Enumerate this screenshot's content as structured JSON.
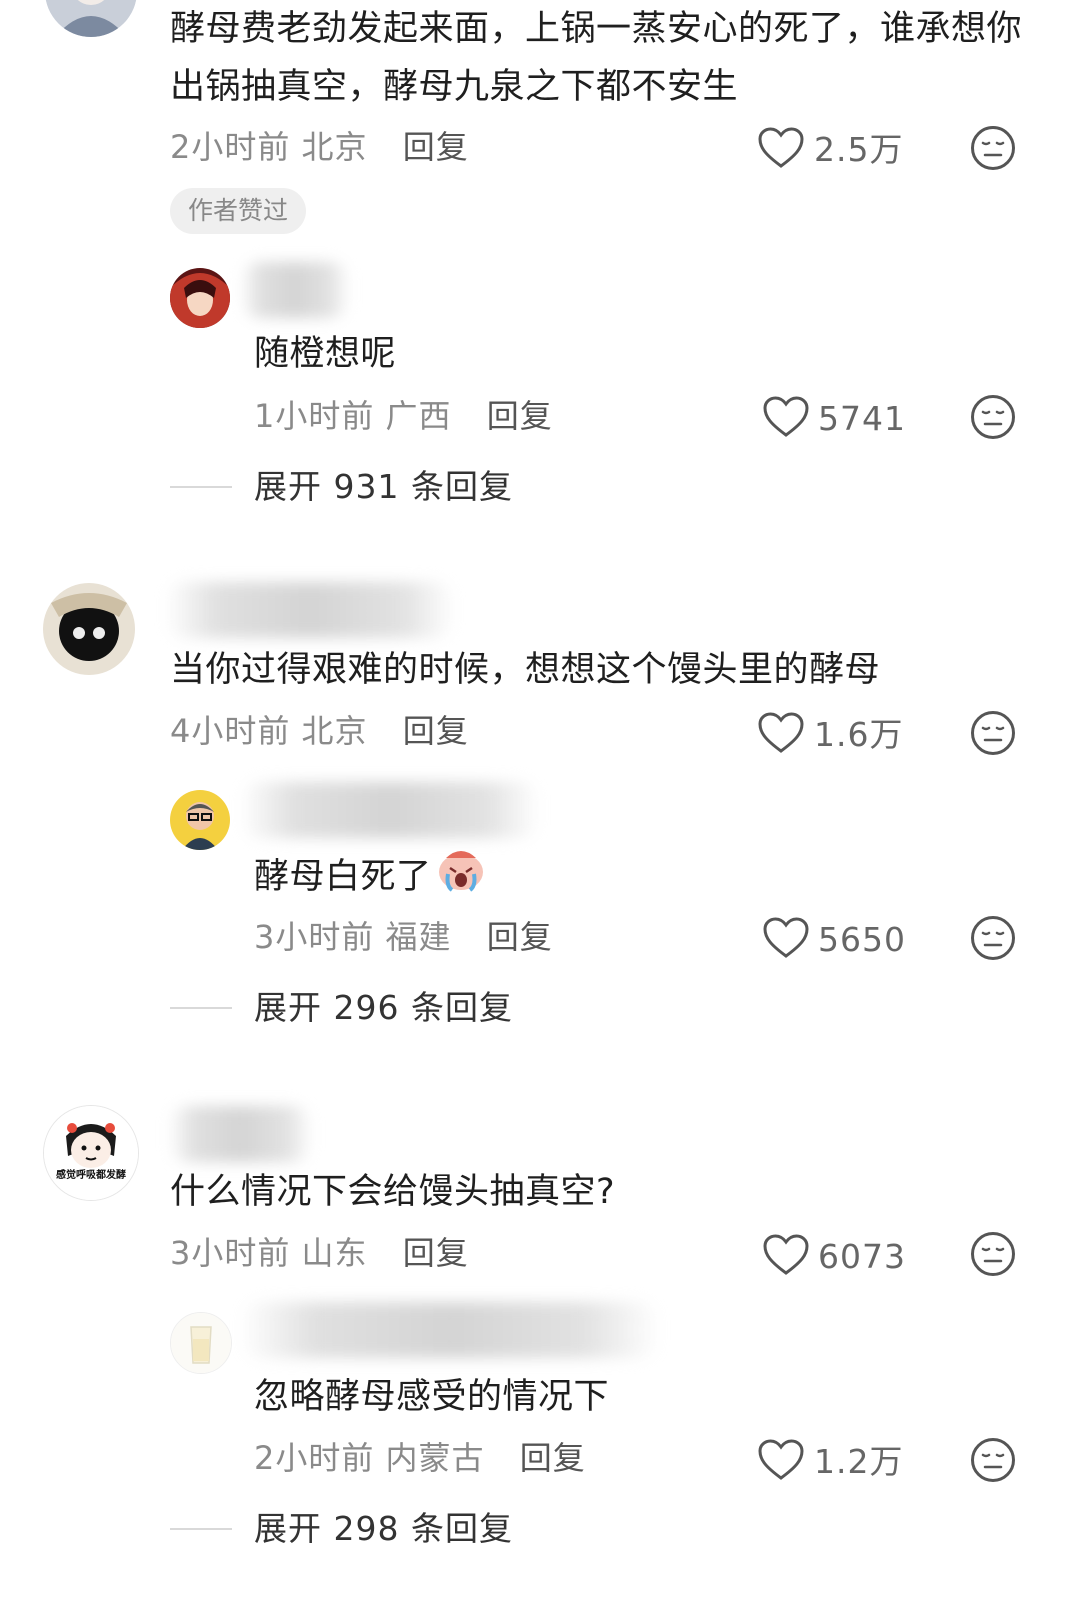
{
  "comments": [
    {
      "text": "酵母费老劲发起来面，上锅一蒸安心的死了，谁承想你出锅抽真空，酵母九泉之下都不安生",
      "time": "2小时前",
      "location": "北京",
      "reply_label": "回复",
      "likes": "2.5万",
      "badge": "作者赞过",
      "replies": [
        {
          "text": "随橙想呢",
          "time": "1小时前",
          "location": "广西",
          "reply_label": "回复",
          "likes": "5741"
        }
      ],
      "expand": "展开 931 条回复"
    },
    {
      "text": "当你过得艰难的时候，想想这个馒头里的酵母",
      "time": "4小时前",
      "location": "北京",
      "reply_label": "回复",
      "likes": "1.6万",
      "replies": [
        {
          "text": "酵母白死了",
          "emoji": "crying-face-emoji",
          "time": "3小时前",
          "location": "福建",
          "reply_label": "回复",
          "likes": "5650"
        }
      ],
      "expand": "展开 296 条回复"
    },
    {
      "text": "什么情况下会给馒头抽真空?",
      "avatar_caption": "感觉呼吸都发酵",
      "time": "3小时前",
      "location": "山东",
      "reply_label": "回复",
      "likes": "6073",
      "replies": [
        {
          "text": "忽略酵母感受的情况下",
          "time": "2小时前",
          "location": "内蒙古",
          "reply_label": "回复",
          "likes": "1.2万"
        }
      ],
      "expand": "展开 298 条回复"
    }
  ],
  "icons": {
    "like": "heart-outline-icon",
    "dislike": "meh-face-icon"
  },
  "colors": {
    "text": "#1f1f1f",
    "meta": "#8a8a8a",
    "icon": "#555555"
  }
}
